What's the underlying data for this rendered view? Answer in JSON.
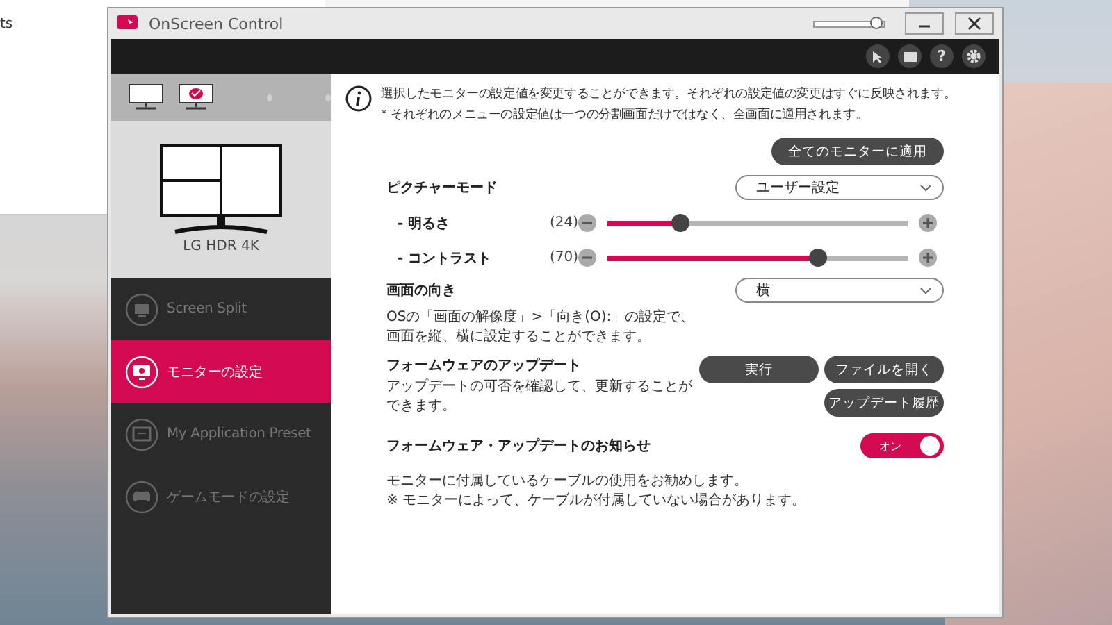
{
  "background_window": {
    "text": "ts"
  },
  "window": {
    "title": "OnScreen Control",
    "opacity_slider": {
      "level": 0.9
    }
  },
  "toolbar": {
    "help_label": "?"
  },
  "monitors": [
    {
      "selected": false
    },
    {
      "selected": true
    }
  ],
  "monitor_name": "LG HDR 4K",
  "nav": [
    {
      "kind": "split",
      "label": "Screen Split",
      "selected": false
    },
    {
      "kind": "settings",
      "label": "モニターの設定",
      "selected": true
    },
    {
      "kind": "preset",
      "label": "My Application Preset",
      "selected": false
    },
    {
      "kind": "game",
      "label": "ゲームモードの設定",
      "selected": false
    }
  ],
  "info": [
    "選択したモニターの設定値を変更することができます。それぞれの設定値の変更はすぐに反映されます。",
    "* それぞれのメニューの設定値は一つの分割画面だけではなく、全画面に適用されます。"
  ],
  "apply_all_button": "全てのモニターに適用",
  "picture_mode": {
    "label": "ピクチャーモード",
    "value": "ユーザー設定"
  },
  "sliders": [
    {
      "label": "- 明るさ",
      "reading": "(24)",
      "level": 0.24
    },
    {
      "label": "- コントラスト",
      "reading": "(70)",
      "level": 0.7
    }
  ],
  "orientation": {
    "label": "画面の向き",
    "value": "横",
    "description": [
      "OSの「画面の解像度」>「向き(O):」の設定で、",
      "画面を縦、横に設定することができます。"
    ]
  },
  "firmware": {
    "title": "フォームウェアのアップデート",
    "description": [
      "アップデートの可否を確認して、更新することが",
      "できます。"
    ],
    "buttons": [
      "実行",
      "ファイルを開く",
      "アップデート履歴"
    ]
  },
  "notification": {
    "label": "フォームウェア・アップデートのお知らせ",
    "toggle": {
      "label": "オン",
      "on": true
    }
  },
  "note": [
    "モニターに付属しているケーブルの使用をお勧めします。",
    "※ モニターによって、ケーブルが付属していない場合があります。"
  ]
}
